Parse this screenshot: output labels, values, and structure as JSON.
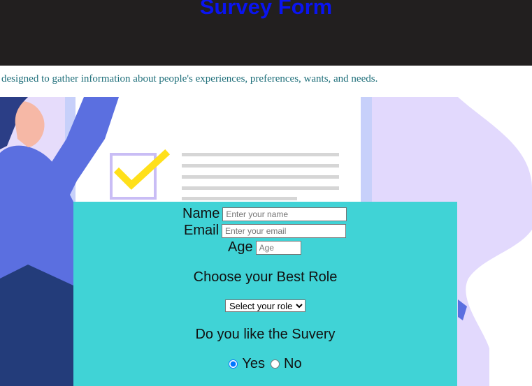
{
  "header": {
    "title": "Survey Form"
  },
  "description": "designed to gather information about people's experiences, preferences, wants, and needs.",
  "form": {
    "name_label": "Name",
    "name_placeholder": "Enter your name",
    "email_label": "Email",
    "email_placeholder": "Enter your email",
    "age_label": "Age",
    "age_placeholder": "Age",
    "role_heading": "Choose your Best Role",
    "role_select_value": "Select your role",
    "like_heading": "Do you like the Suvery",
    "radio_yes": "Yes",
    "radio_no": "No",
    "selected": "Yes"
  },
  "colors": {
    "header_bg": "#221f1f",
    "title": "#0a14f0",
    "form_bg": "#40d3d6",
    "description": "#1f6f7a"
  }
}
